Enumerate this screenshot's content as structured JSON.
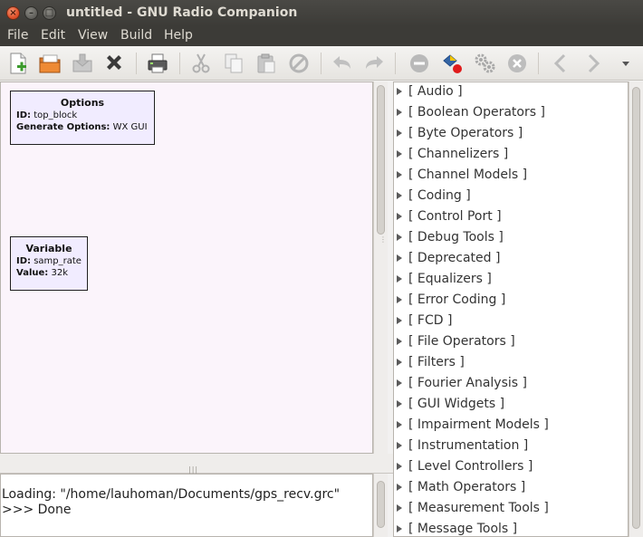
{
  "window": {
    "title": "untitled - GNU Radio Companion",
    "controls": [
      "close-icon",
      "minimize-icon",
      "maximize-icon"
    ]
  },
  "menubar": {
    "items": [
      "File",
      "Edit",
      "View",
      "Build",
      "Help"
    ]
  },
  "toolbar": {
    "buttons": [
      {
        "name": "new-icon",
        "enabled": true
      },
      {
        "name": "open-icon",
        "enabled": true
      },
      {
        "name": "save-icon",
        "enabled": false
      },
      {
        "name": "close-icon",
        "enabled": true
      },
      {
        "name": "print-icon",
        "enabled": true
      },
      {
        "name": "cut-icon",
        "enabled": false
      },
      {
        "name": "copy-icon",
        "enabled": false
      },
      {
        "name": "paste-icon",
        "enabled": false
      },
      {
        "name": "delete-icon",
        "enabled": false
      },
      {
        "name": "undo-icon",
        "enabled": false
      },
      {
        "name": "redo-icon",
        "enabled": false
      },
      {
        "name": "disable-block-icon",
        "enabled": false
      },
      {
        "name": "generate-icon",
        "enabled": true
      },
      {
        "name": "execute-icon",
        "enabled": false
      },
      {
        "name": "kill-icon",
        "enabled": false
      },
      {
        "name": "rotate-ccw-icon",
        "enabled": false
      },
      {
        "name": "rotate-cw-icon",
        "enabled": false
      },
      {
        "name": "overflow-menu-icon",
        "enabled": true
      }
    ]
  },
  "canvas": {
    "blocks": [
      {
        "title": "Options",
        "params": [
          {
            "key": "ID:",
            "value": "top_block"
          },
          {
            "key": "Generate Options:",
            "value": "WX GUI"
          }
        ]
      },
      {
        "title": "Variable",
        "params": [
          {
            "key": "ID:",
            "value": "samp_rate"
          },
          {
            "key": "Value:",
            "value": "32k"
          }
        ]
      }
    ]
  },
  "console": {
    "lines": [
      "Loading: \"/home/lauhoman/Documents/gps_recv.grc\"",
      ">>> Done"
    ]
  },
  "block_tree": {
    "categories": [
      "[ Audio ]",
      "[ Boolean Operators ]",
      "[ Byte Operators ]",
      "[ Channelizers ]",
      "[ Channel Models ]",
      "[ Coding ]",
      "[ Control Port ]",
      "[ Debug Tools ]",
      "[ Deprecated ]",
      "[ Equalizers ]",
      "[ Error Coding ]",
      "[ FCD ]",
      "[ File Operators ]",
      "[ Filters ]",
      "[ Fourier Analysis ]",
      "[ GUI Widgets ]",
      "[ Impairment Models ]",
      "[ Instrumentation ]",
      "[ Level Controllers ]",
      "[ Math Operators ]",
      "[ Measurement Tools ]",
      "[ Message Tools ]"
    ]
  },
  "colors": {
    "titlebar": "#3c3b37",
    "canvas_bg": "#fbf4fb",
    "block_bg": "#f1ecff",
    "close_button": "#e0512b"
  }
}
